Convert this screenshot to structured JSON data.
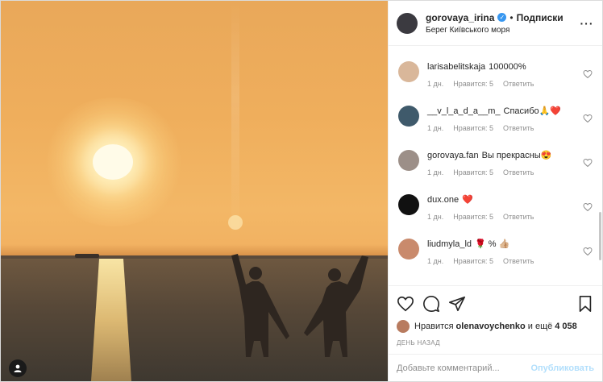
{
  "post": {
    "username": "gorovaya_irina",
    "follow_label": "Подписки",
    "location": "Берег Київського моря",
    "more_icon": "more-dots-icon"
  },
  "comments": [
    {
      "user": "larisabelitskaja",
      "text": "100000%",
      "time": "1 дн.",
      "like": "Нравится: 5",
      "reply": "Ответить",
      "avatar_color": "#d9b79a"
    },
    {
      "user": "__v_l_a_d_a__m_",
      "text": "Спасибо🙏❤️",
      "time": "1 дн.",
      "like": "Нравится: 5",
      "reply": "Ответить",
      "avatar_color": "#3f5a6b"
    },
    {
      "user": "gorovaya.fan",
      "text": "Вы прекрасны😍",
      "time": "1 дн.",
      "like": "Нравится: 5",
      "reply": "Ответить",
      "avatar_color": "#9c8f88"
    },
    {
      "user": "dux.one",
      "text": "❤️",
      "time": "1 дн.",
      "like": "Нравится: 5",
      "reply": "Ответить",
      "avatar_color": "#111111"
    },
    {
      "user": "liudmyla_ld",
      "text": "🌹 % 👍🏼",
      "time": "1 дн.",
      "like": "Нравится: 5",
      "reply": "Ответить",
      "avatar_color": "#c98a6c"
    }
  ],
  "likes": {
    "prefix": "Нравится",
    "name": "olenavoychenko",
    "suffix": "и ещё",
    "count": "4 058"
  },
  "date": "ДЕНЬ НАЗАД",
  "add_comment": {
    "placeholder": "Добавьте комментарий...",
    "publish_label": "Опубликовать"
  }
}
